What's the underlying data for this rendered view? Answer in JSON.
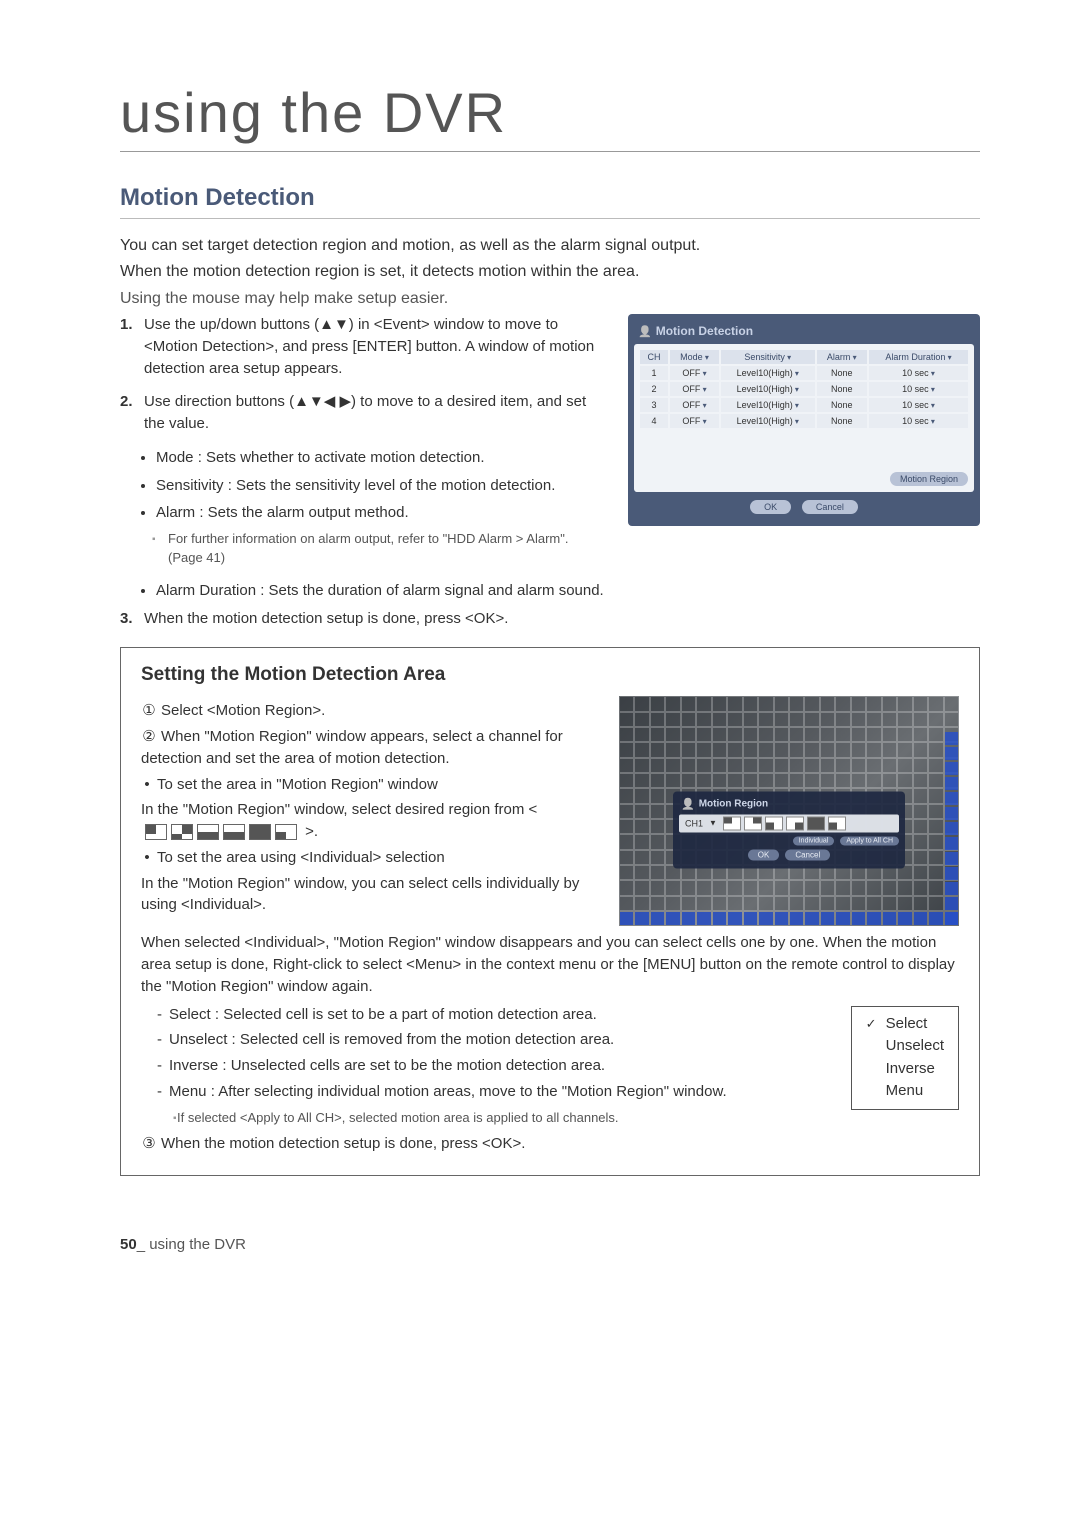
{
  "chapter_title": "using the DVR",
  "section_title": "Motion Detection",
  "intro": {
    "p1": "You can set target detection region and motion, as well as the alarm signal output.",
    "p2": "When the motion detection region is set, it detects motion within the area.",
    "note": "Using the mouse may help make setup easier."
  },
  "steps": {
    "s1_num": "1.",
    "s1": "Use the up/down buttons (▲▼) in <Event> window to move to <Motion Detection>, and press [ENTER] button. A window of motion detection area setup appears.",
    "s2_num": "2.",
    "s2": "Use direction buttons (▲▼◀ ▶) to move to a desired item, and set the value.",
    "b_mode": "Mode : Sets whether to activate motion detection.",
    "b_sens": "Sensitivity : Sets the sensitivity level of the motion detection.",
    "b_alarm": "Alarm : Sets the alarm output method.",
    "alarm_sub": "For further information on alarm output, refer to \"HDD Alarm > Alarm\". (Page 41)",
    "b_dur": "Alarm Duration : Sets the duration of alarm signal and alarm sound.",
    "s3_num": "3.",
    "s3": "When the motion detection setup is done, press <OK>."
  },
  "dialog": {
    "title": "Motion Detection",
    "headers": {
      "ch": "CH",
      "mode": "Mode",
      "sens": "Sensitivity",
      "alarm": "Alarm",
      "dur": "Alarm Duration"
    },
    "rows": [
      {
        "ch": "1",
        "mode": "OFF",
        "sens": "Level10(High)",
        "alarm": "None",
        "dur": "10 sec"
      },
      {
        "ch": "2",
        "mode": "OFF",
        "sens": "Level10(High)",
        "alarm": "None",
        "dur": "10 sec"
      },
      {
        "ch": "3",
        "mode": "OFF",
        "sens": "Level10(High)",
        "alarm": "None",
        "dur": "10 sec"
      },
      {
        "ch": "4",
        "mode": "OFF",
        "sens": "Level10(High)",
        "alarm": "None",
        "dur": "10 sec"
      }
    ],
    "region_btn": "Motion Region",
    "ok": "OK",
    "cancel": "Cancel"
  },
  "inset": {
    "title": "Setting the Motion Detection Area",
    "n1": "①",
    "t1": "Select <Motion Region>.",
    "n2": "②",
    "t2": "When \"Motion Region\" window appears, select a channel for detection and set the area of motion detection.",
    "b1": "To set the area in \"Motion Region\" window",
    "p1a": "In the \"Motion Region\" window, select desired region from <",
    "p1b": ">.",
    "b2": "To set the area using <Individual> selection",
    "p2": "In the \"Motion Region\" window, you can select cells individually by using <Individual>.",
    "p3": "When selected <Individual>, \"Motion Region\" window disappears and you can select cells one by one. When the motion area setup is done, Right-click to select <Menu> in the context menu or the [MENU] button on the remote control to display the \"Motion Region\" window again.",
    "d1": "Select : Selected cell is set to be a part of motion detection area.",
    "d2": "Unselect : Selected cell is removed from the motion detection area.",
    "d3": "Inverse : Unselected cells are set to be the motion detection area.",
    "d4": "Menu : After selecting individual motion areas, move to the \"Motion Region\" window.",
    "sub": "If selected <Apply to All CH>, selected motion area is applied to all channels.",
    "n3": "③",
    "t3": "When the motion detection setup is done, press <OK>."
  },
  "mr_dialog": {
    "title": "Motion Region",
    "ch_label": "CH1",
    "individual": "Individual",
    "apply": "Apply to All CH",
    "ok": "OK",
    "cancel": "Cancel"
  },
  "ctx": {
    "select": "Select",
    "unselect": "Unselect",
    "inverse": "Inverse",
    "menu": "Menu"
  },
  "footer": {
    "page": "50",
    "sep": "_",
    "text": " using the DVR"
  }
}
